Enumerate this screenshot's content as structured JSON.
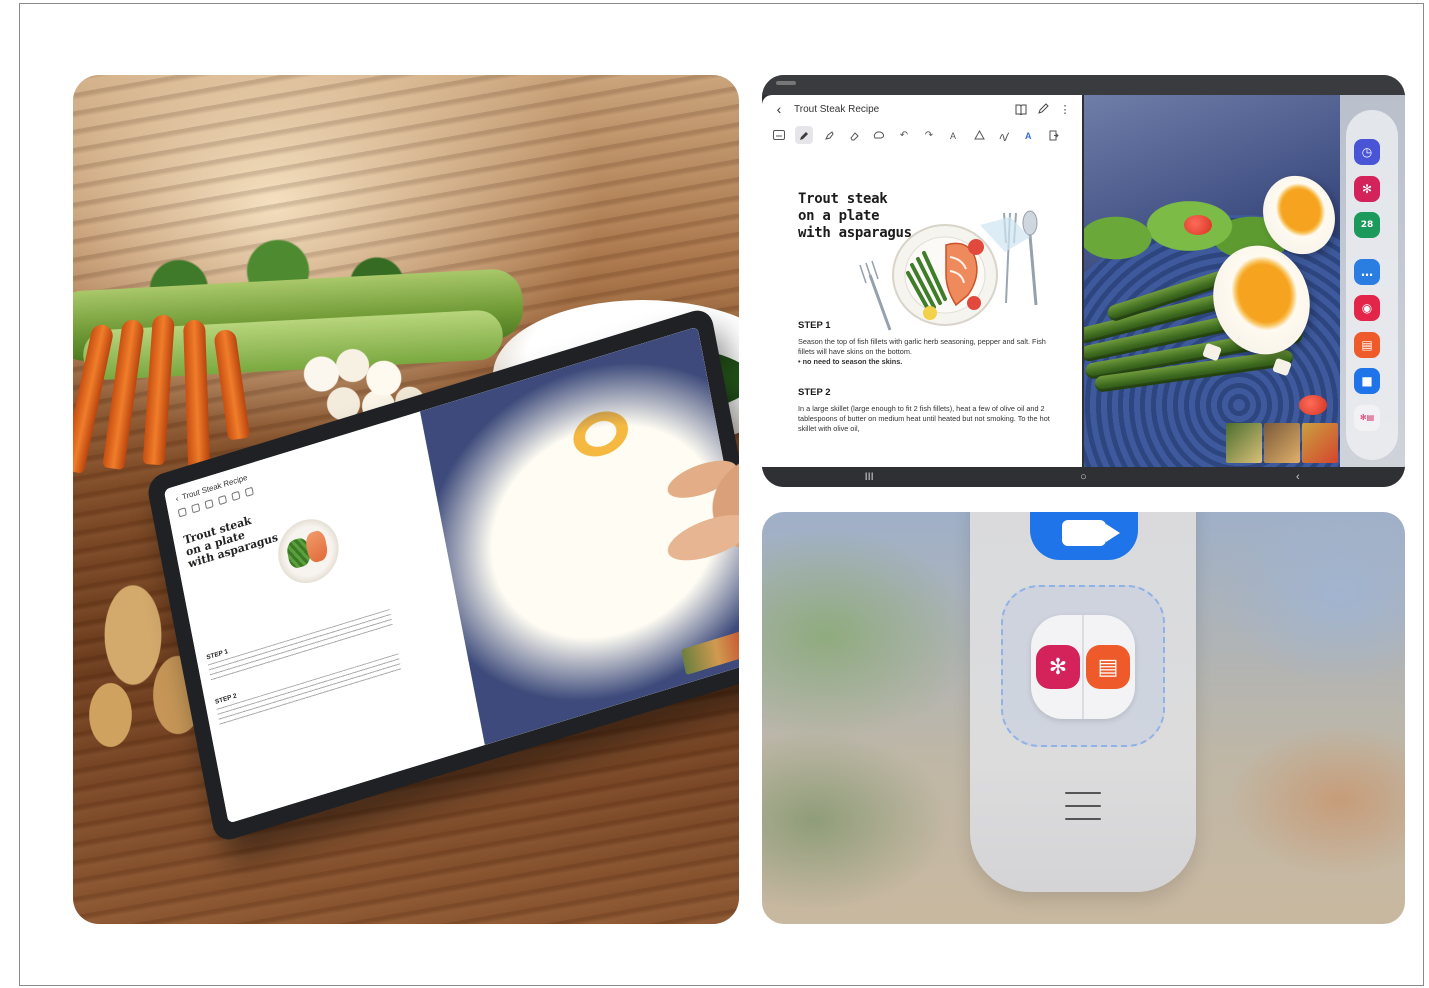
{
  "left_photo": {
    "tablet_screen": {
      "app_title": "Trout Steak Recipe",
      "handwritten_title": "Trout steak\non a plate\nwith asparagus",
      "step1_label": "STEP 1",
      "step2_label": "STEP 2"
    }
  },
  "split_screen": {
    "note_app": {
      "title": "Trout Steak Recipe",
      "header_icons": [
        "book-icon",
        "pen-icon",
        "more-icon"
      ],
      "toolbar_icons": [
        "keyboard-icon",
        "pen-tool-icon",
        "highlighter-icon",
        "eraser-icon",
        "lasso-icon",
        "undo-icon",
        "redo-icon",
        "text-icon",
        "shape-icon",
        "handwriting-icon",
        "reading-mode-icon",
        "share-icon"
      ],
      "handwritten_title": [
        "Trout steak",
        "on a plate",
        "with asparagus"
      ],
      "step1": {
        "label": "STEP 1",
        "body": "Season the top of fish fillets with garlic herb seasoning, pepper and salt. Fish fillets will have skins on the bottom.",
        "note": "• no need to season the skins."
      },
      "step2": {
        "label": "STEP 2",
        "body": "In a large skillet (large enough to fit 2 fish fillets), heat a few of olive oil and 2 tablespoons of butter on medium heat until heated but not smoking. To the hot skillet with olive oil,"
      }
    },
    "edge_panel_apps": [
      {
        "name": "clock",
        "icon": "clock-icon",
        "color": "#4a54d6",
        "glyph": "◷"
      },
      {
        "name": "gallery",
        "icon": "gallery-flower-icon",
        "color": "#d4235b",
        "glyph": "✻"
      },
      {
        "name": "calendar",
        "icon": "calendar-icon",
        "color": "#1b9a5c",
        "glyph": "28"
      },
      {
        "name": "messages",
        "icon": "messages-icon",
        "color": "#2a7de1",
        "glyph": "…"
      },
      {
        "name": "camera",
        "icon": "camera-icon",
        "color": "#e3254a",
        "glyph": "◉"
      },
      {
        "name": "notes",
        "icon": "notes-icon",
        "color": "#ef5a2a",
        "glyph": "▤"
      },
      {
        "name": "video-call",
        "icon": "video-call-icon",
        "color": "#1e74e8",
        "glyph": "■"
      },
      {
        "name": "app-pair",
        "icon": "app-pair-icon",
        "color": "#f2f2f4",
        "glyph": "✻▤"
      }
    ],
    "nav_bar": {
      "recents": "III",
      "home": "○",
      "back": "‹"
    }
  },
  "zoom_panel": {
    "menu_glyph": "☰",
    "pair_left_glyph": "✻",
    "pair_right_glyph": "▤",
    "pair_left_color": "#d4235b",
    "pair_right_color": "#ef5a2a"
  }
}
